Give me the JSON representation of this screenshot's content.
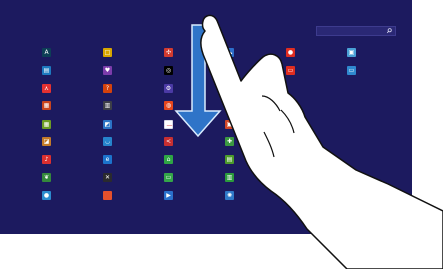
{
  "screen": {
    "background": "#1c1a5f",
    "search_value": ""
  },
  "apps": [
    {
      "icon": "font-icon",
      "color": "#0d3f56",
      "glyph": "A"
    },
    {
      "icon": "sticky-note-icon",
      "color": "#d8a600",
      "glyph": "□"
    },
    {
      "icon": "fan-icon",
      "color": "#d23a2f",
      "glyph": "✣"
    },
    {
      "icon": "cloud-icon",
      "color": "#2d6fcb",
      "glyph": "☁"
    },
    {
      "icon": "microphone-icon",
      "color": "#df2d21",
      "glyph": "●"
    },
    {
      "icon": "picture-icon",
      "color": "#4aa1d6",
      "glyph": "▣"
    },
    {
      "icon": "document-icon",
      "color": "#1d79bf",
      "glyph": "▤"
    },
    {
      "icon": "heart-icon",
      "color": "#7c3cab",
      "glyph": "♥"
    },
    {
      "icon": "circle-app-icon",
      "color": "#000000",
      "glyph": "◎"
    },
    {
      "icon": "rectangle-icon",
      "color": "#e02d20",
      "glyph": "▭"
    },
    {
      "icon": "monitor-icon",
      "color": "#2f89cf",
      "glyph": "▭"
    },
    {
      "icon": "pdf-icon",
      "color": "#e53131",
      "glyph": "⋏"
    },
    {
      "icon": "question-icon",
      "color": "#d4420c",
      "glyph": "?"
    },
    {
      "icon": "gear-icon",
      "color": "#4b3aa5",
      "glyph": "⚙"
    },
    {
      "icon": "cloud-icon",
      "color": "#2e70c7",
      "glyph": "☁"
    },
    {
      "icon": "media-icon",
      "color": "#c9441d",
      "glyph": "▦"
    },
    {
      "icon": "film-icon",
      "color": "#3c3e47",
      "glyph": "▥"
    },
    {
      "icon": "office-icon",
      "color": "#e5461d",
      "glyph": "◍"
    },
    {
      "icon": "globe-icon",
      "color": "#2c7fd3",
      "glyph": "◉"
    },
    {
      "icon": "calendar-icon",
      "color": "#6c9c24",
      "glyph": "▦"
    },
    {
      "icon": "chat-icon",
      "color": "#2b73c6",
      "glyph": "◩"
    },
    {
      "icon": "bar-icon",
      "color": "#ffffff",
      "glyph": "—"
    },
    {
      "icon": "presentation-icon",
      "color": "#d24728",
      "glyph": "▣"
    },
    {
      "icon": "photo-icon",
      "color": "#c37a28",
      "glyph": "◪"
    },
    {
      "icon": "browser-icon",
      "color": "#2684cc",
      "glyph": "◡"
    },
    {
      "icon": "share-icon",
      "color": "#c72f31",
      "glyph": "<"
    },
    {
      "icon": "gamepad-icon",
      "color": "#3c9942",
      "glyph": "✚"
    },
    {
      "icon": "music-icon",
      "color": "#db2f2f",
      "glyph": "♪"
    },
    {
      "icon": "internet-explorer-icon",
      "color": "#1c73cc",
      "glyph": "e"
    },
    {
      "icon": "store-icon",
      "color": "#2ea644",
      "glyph": "⌂"
    },
    {
      "icon": "calculator-icon",
      "color": "#4c9b2a",
      "glyph": "▤"
    },
    {
      "icon": "leaf-icon",
      "color": "#34883b",
      "glyph": "❦"
    },
    {
      "icon": "tools-icon",
      "color": "#2a2a2e",
      "glyph": "✕"
    },
    {
      "icon": "message-icon",
      "color": "#34a649",
      "glyph": "▭"
    },
    {
      "icon": "chart-icon",
      "color": "#2b9b3c",
      "glyph": "▥"
    },
    {
      "icon": "disc-icon",
      "color": "#2c8ccf",
      "glyph": "●"
    },
    {
      "icon": "blank-app-icon",
      "color": "#e5502c",
      "glyph": ""
    },
    {
      "icon": "play-icon",
      "color": "#2a70cc",
      "glyph": "▶"
    },
    {
      "icon": "sun-icon",
      "color": "#2f79c9",
      "glyph": "✺"
    }
  ],
  "gesture": {
    "arrow_color": "#2f74c8",
    "hand_fill": "#ffffff",
    "hand_stroke": "#111111"
  }
}
